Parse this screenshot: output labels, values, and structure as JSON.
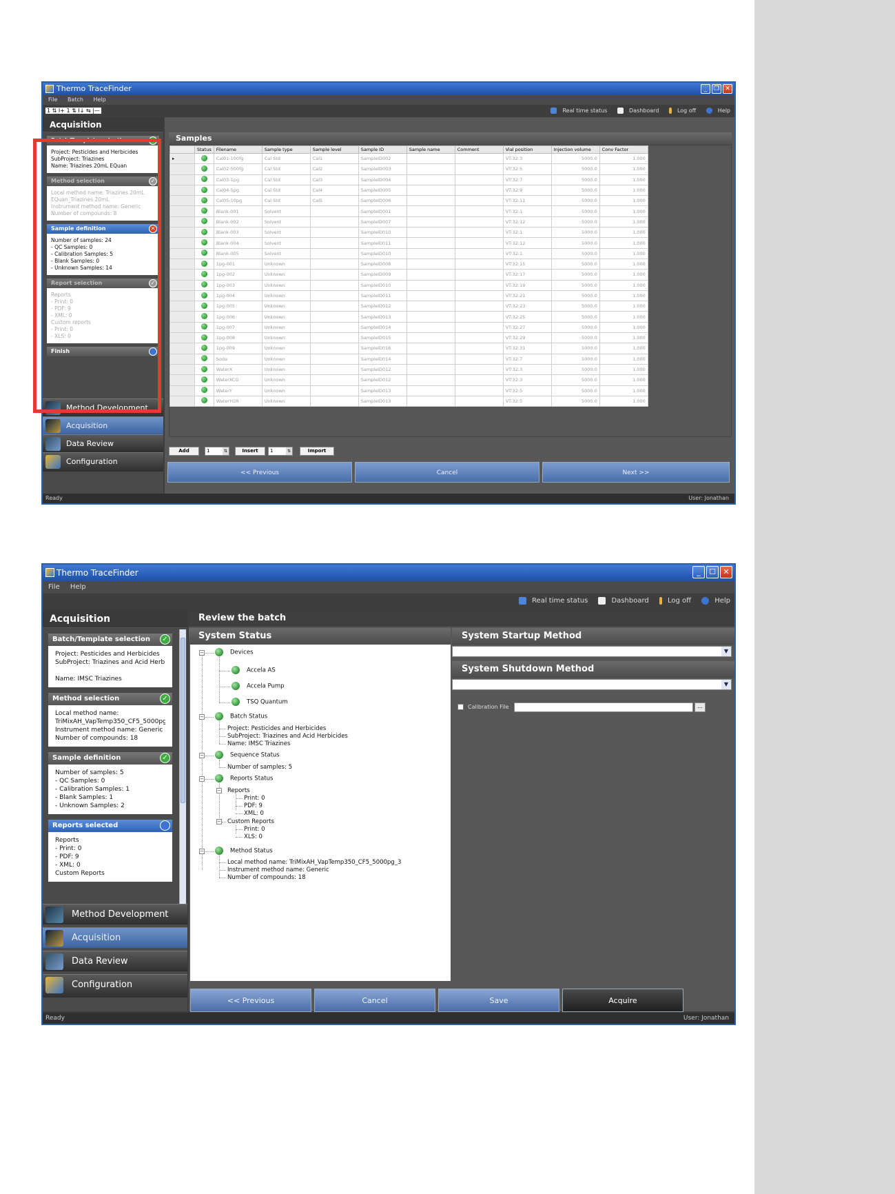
{
  "colors": {
    "window_border": "#2b5fa8",
    "accent_blue": "#3d74d1",
    "highlight_red": "#e53935",
    "status_green": "#1a9a2a"
  },
  "win1": {
    "title": "Thermo TraceFinder",
    "menu": [
      "File",
      "Batch",
      "Help"
    ],
    "toolbar_right": [
      "Real time status",
      "Dashboard",
      "Log off",
      "Help"
    ],
    "panel_title": "Acquisition",
    "cards": [
      {
        "title": "Batch/Template selection",
        "status": "ok",
        "lines": [
          "Project:  Pesticides and Herbicides",
          "SubProject: Triazines",
          "Name: Triazines 20mL EQuan"
        ]
      },
      {
        "title": "Method selection",
        "status": "done",
        "lines": [
          "Local method name: Triazines 20mL",
          "EQuan_Triazines 20mL",
          "Instrument method name: Generic",
          "Number of compounds: 8"
        ]
      },
      {
        "title": "Sample definition",
        "status": "error",
        "lines": [
          "Number of samples: 24",
          " - QC Samples: 0",
          " - Calibration Samples: 5",
          " - Blank Samples: 0",
          " - Unknown Samples: 14"
        ]
      },
      {
        "title": "Report selection",
        "status": "done",
        "lines": [
          "Reports",
          " - Print: 0",
          " - PDF: 9",
          " - XML: 0",
          "Custom reports",
          " - Print: 0",
          " - XLS: 0"
        ]
      },
      {
        "title": "Finish",
        "status": "pending"
      }
    ],
    "nav": [
      "Method Development",
      "Acquisition",
      "Data Review",
      "Configuration"
    ],
    "section_title": "Samples",
    "columns": [
      "Status",
      "Filename",
      "Sample type",
      "Sample level",
      "Sample ID",
      "Sample name",
      "Comment",
      "Vial position",
      "Injection volume",
      "Conv Factor"
    ],
    "rows": [
      [
        "Cal01-100fg",
        "Cal Std",
        "Cal1",
        "SampleID002",
        "VT:32:3",
        "5000.0",
        "1.000"
      ],
      [
        "Cal02-500fg",
        "Cal Std",
        "Cal2",
        "SampleID003",
        "VT:32:5",
        "5000.0",
        "1.000"
      ],
      [
        "Cal03-1pg",
        "Cal Std",
        "Cal3",
        "SampleID004",
        "VT:32:7",
        "5000.0",
        "1.000"
      ],
      [
        "Cal04-5pg",
        "Cal Std",
        "Cal4",
        "SampleID005",
        "VT:32:9",
        "5000.0",
        "1.000"
      ],
      [
        "Cal05-10pg",
        "Cal Std",
        "Cal5",
        "SampleID006",
        "VT:32:11",
        "5000.0",
        "1.000"
      ],
      [
        "Blank-001",
        "Solvent",
        "",
        "SampleID001",
        "VT:32:1",
        "5000.0",
        "1.000"
      ],
      [
        "Blank-002",
        "Solvent",
        "",
        "SampleID007",
        "VT:32:12",
        "5000.0",
        "1.000"
      ],
      [
        "Blank-003",
        "Solvent",
        "",
        "SampleID010",
        "VT:32:1",
        "5000.0",
        "1.000"
      ],
      [
        "Blank-004",
        "Solvent",
        "",
        "SampleID011",
        "VT:32:12",
        "5000.0",
        "1.000"
      ],
      [
        "Blank-005",
        "Solvent",
        "",
        "SampleID010",
        "VT:32:1",
        "5000.0",
        "1.000"
      ],
      [
        "1pg-001",
        "Unknown",
        "",
        "SampleID008",
        "VT:32:15",
        "5000.0",
        "1.000"
      ],
      [
        "1pg-002",
        "Unknown",
        "",
        "SampleID009",
        "VT:32:17",
        "5000.0",
        "1.000"
      ],
      [
        "1pg-003",
        "Unknown",
        "",
        "SampleID010",
        "VT:32:19",
        "5000.0",
        "1.000"
      ],
      [
        "1pg-004",
        "Unknown",
        "",
        "SampleID011",
        "VT:32:21",
        "5000.0",
        "1.000"
      ],
      [
        "1pg-005",
        "Unknown",
        "",
        "SampleID012",
        "VT:32:23",
        "5000.0",
        "1.000"
      ],
      [
        "1pg-006",
        "Unknown",
        "",
        "SampleID013",
        "VT:32:25",
        "5000.0",
        "1.000"
      ],
      [
        "1pg-007",
        "Unknown",
        "",
        "SampleID014",
        "VT:32:27",
        "5000.0",
        "1.000"
      ],
      [
        "1pg-008",
        "Unknown",
        "",
        "SampleID015",
        "VT:32:29",
        "5000.0",
        "1.000"
      ],
      [
        "1pg-009",
        "Unknown",
        "",
        "SampleID016",
        "VT:32:31",
        "5000.0",
        "1.000"
      ],
      [
        "Soda",
        "Unknown",
        "",
        "SampleID014",
        "VT:32:7",
        "5000.0",
        "1.000"
      ],
      [
        "WaterX",
        "Unknown",
        "",
        "SampleID012",
        "VT:32:3",
        "5000.0",
        "1.000"
      ],
      [
        "WaterXCG",
        "Unknown",
        "",
        "SampleID012",
        "VT:32:3",
        "5000.0",
        "1.000"
      ],
      [
        "WaterY",
        "Unknown",
        "",
        "SampleID013",
        "VT:32:5",
        "5000.0",
        "1.000"
      ],
      [
        "WaterYGR",
        "Unknown",
        "",
        "SampleID013",
        "VT:32:5",
        "5000.0",
        "1.000"
      ]
    ],
    "add_label": "Add",
    "add_count": "1",
    "insert_label": "Insert",
    "insert_count": "1",
    "import_label": "Import",
    "prev_label": "<< Previous",
    "cancel_label": "Cancel",
    "next_label": "Next >>",
    "status": "Ready",
    "user": "User: Jonathan"
  },
  "win2": {
    "title": "Thermo TraceFinder",
    "menu": [
      "File",
      "Help"
    ],
    "toolbar_right": [
      "Real time status",
      "Dashboard",
      "Log off",
      "Help"
    ],
    "panel_title": "Acquisition",
    "cards": [
      {
        "title": "Batch/Template selection",
        "status": "ok",
        "lines": [
          "Project:  Pesticides and Herbicides",
          "SubProject: Triazines and Acid Herbicides",
          "",
          "Name: IMSC Triazines"
        ]
      },
      {
        "title": "Method selection",
        "status": "ok",
        "lines": [
          "Local method name:",
          "TriMixAH_VapTemp350_CF5_5000pg_3",
          "Instrument method name: Generic",
          "Number of compounds: 18"
        ]
      },
      {
        "title": "Sample definition",
        "status": "ok",
        "lines": [
          "Number of samples: 5",
          " - QC Samples: 0",
          " - Calibration Samples: 1",
          " - Blank Samples: 1",
          " - Unknown Samples: 2"
        ]
      },
      {
        "title": "Reports selected",
        "status": "pending",
        "lines": [
          "Reports",
          " - Print: 0",
          " - PDF: 9",
          " - XML: 0",
          "Custom Reports"
        ]
      }
    ],
    "nav": [
      "Method Development",
      "Acquisition",
      "Data Review",
      "Configuration"
    ],
    "review_title": "Review the batch",
    "system_status_title": "System Status",
    "tree": {
      "devices": "Devices",
      "device_items": [
        "Accela AS",
        "Accela Pump",
        "TSQ Quantum"
      ],
      "batch_status": "Batch Status",
      "batch_items": [
        "Project:  Pesticides and Herbicides",
        "SubProject: Triazines and Acid Herbicides",
        "Name: IMSC Triazines"
      ],
      "sequence_status": "Sequence Status",
      "sequence_items": [
        "Number of samples: 5"
      ],
      "reports_status": "Reports Status",
      "reports": "Reports",
      "report_items": [
        "Print: 0",
        "PDF: 9",
        "XML: 0"
      ],
      "custom_reports": "Custom Reports",
      "custom_items": [
        "Print: 0",
        "XLS: 0"
      ],
      "method_status": "Method Status",
      "method_items": [
        "Local method name: TriMixAH_VapTemp350_CF5_5000pg_3",
        "Instrument method name: Generic",
        "Number of compounds: 18"
      ]
    },
    "startup_title": "System Startup Method",
    "shutdown_title": "System Shutdown Method",
    "calibration_label": "Calibration File",
    "prev_label": "<< Previous",
    "cancel_label": "Cancel",
    "save_label": "Save",
    "acquire_label": "Acquire",
    "status": "Ready",
    "user": "User: Jonathan"
  }
}
